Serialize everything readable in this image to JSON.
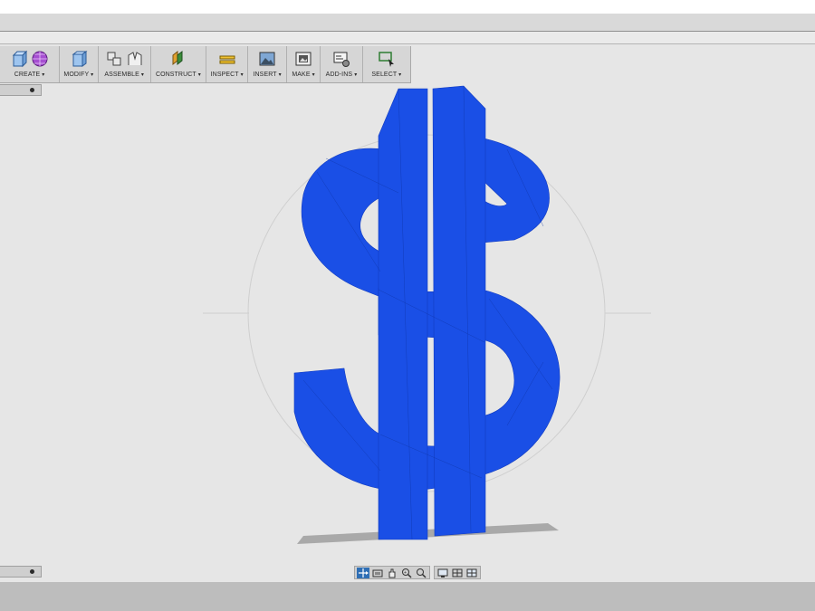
{
  "toolbar": {
    "groups": [
      {
        "label": "CREATE",
        "icons": [
          "extrude-box-icon",
          "sculpt-sphere-icon"
        ]
      },
      {
        "label": "MODIFY",
        "icons": [
          "press-pull-icon"
        ]
      },
      {
        "label": "ASSEMBLE",
        "icons": [
          "new-component-icon",
          "joint-icon"
        ]
      },
      {
        "label": "CONSTRUCT",
        "icons": [
          "offset-plane-icon"
        ]
      },
      {
        "label": "INSPECT",
        "icons": [
          "measure-icon"
        ]
      },
      {
        "label": "INSERT",
        "icons": [
          "insert-image-icon"
        ]
      },
      {
        "label": "MAKE",
        "icons": [
          "3d-print-icon"
        ]
      },
      {
        "label": "ADD-INS",
        "icons": [
          "scripts-addins-icon"
        ]
      },
      {
        "label": "SELECT",
        "icons": [
          "select-window-icon"
        ]
      }
    ],
    "dropdown_caret": "▾"
  },
  "model": {
    "name": "dollar-sign",
    "color": "#1a4fe6"
  },
  "navbar": {
    "tools": [
      "orbit-icon",
      "look-at-icon",
      "pan-icon",
      "zoom-window-icon",
      "fit-zoom-icon",
      "display-settings-icon",
      "grid-settings-icon",
      "viewports-icon"
    ]
  },
  "colors": {
    "viewport_bg": "#e6e6e6",
    "toolbar_bg": "#d6d6d6",
    "accent": "#2f6fb5",
    "statusbar": "#bdbdbd"
  }
}
